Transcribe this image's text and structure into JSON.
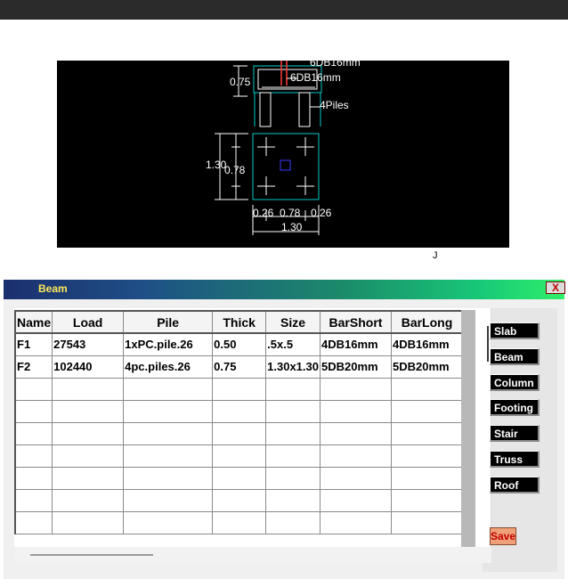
{
  "window": {
    "title": "Beam",
    "close_label": "X"
  },
  "drawing": {
    "labels": {
      "rebar_top": "6DB16mm",
      "rebar_mid": "6DB16mm",
      "piles": "4Piles",
      "column_height": "0.75",
      "footing_depth": "1.30",
      "pile_spacing_y": "0.78",
      "dim_left": "0.26",
      "dim_mid": "0.78",
      "dim_right": "0.26",
      "dim_total": "1.30"
    },
    "mark": "J",
    "colors": {
      "outline": "#00c8c8",
      "rebar": "#ff3a3a",
      "dimension": "#ffffff",
      "column": "#3a3aff"
    }
  },
  "table": {
    "columns": [
      "Name",
      "Load",
      "Pile",
      "Thick",
      "Size",
      "BarShort",
      "BarLong"
    ],
    "rows": [
      [
        "F1",
        "27543",
        "1xPC.pile.26",
        "0.50",
        ".5x.5",
        "4DB16mm",
        "4DB16mm"
      ],
      [
        "F2",
        "102440",
        "4pc.piles.26",
        "0.75",
        "1.30x1.30",
        "5DB20mm",
        "5DB20mm"
      ],
      [
        "",
        "",
        "",
        "",
        "",
        "",
        ""
      ],
      [
        "",
        "",
        "",
        "",
        "",
        "",
        ""
      ],
      [
        "",
        "",
        "",
        "",
        "",
        "",
        ""
      ],
      [
        "",
        "",
        "",
        "",
        "",
        "",
        ""
      ],
      [
        "",
        "",
        "",
        "",
        "",
        "",
        ""
      ],
      [
        "",
        "",
        "",
        "",
        "",
        "",
        ""
      ],
      [
        "",
        "",
        "",
        "",
        "",
        "",
        ""
      ]
    ]
  },
  "side_buttons": [
    "Slab",
    "Beam",
    "Column",
    "Footing",
    "Stair",
    "Truss",
    "Roof"
  ],
  "save_label": "Save",
  "colors": {
    "titlebar_start": "#1b2f6e",
    "titlebar_end": "#2ef06a",
    "title_text": "#ffe95a",
    "save_bg": "#f0a078"
  }
}
